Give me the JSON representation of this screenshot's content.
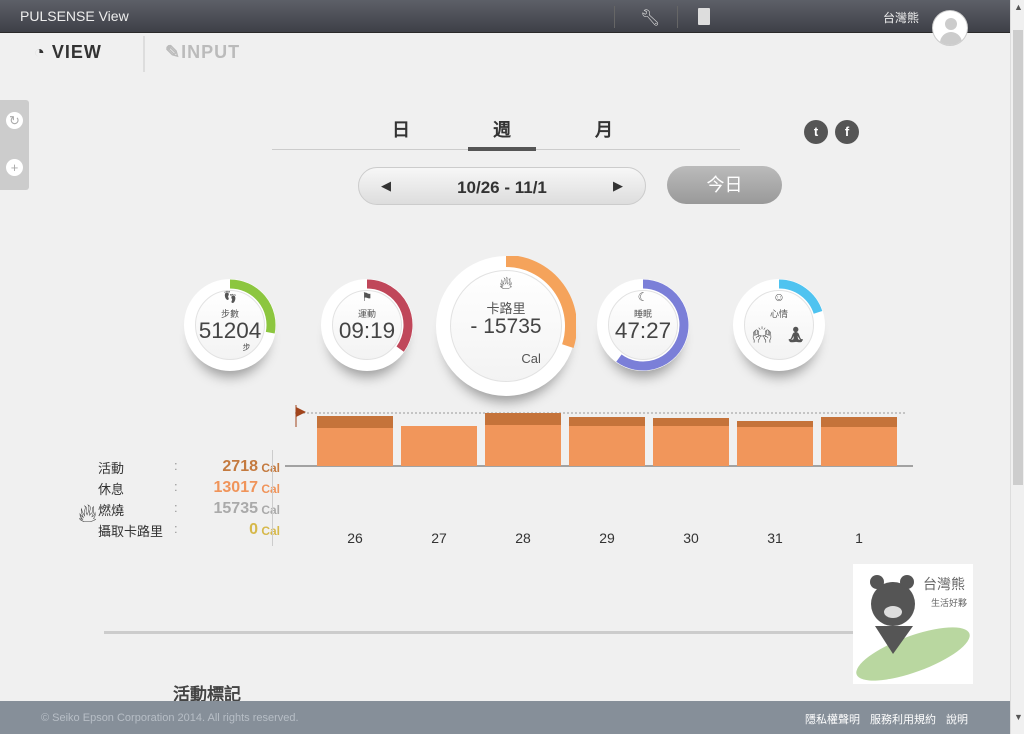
{
  "app": {
    "title": "PULSENSE View",
    "user": "台灣熊",
    "icons": [
      "wrench-icon",
      "door-exit-icon"
    ]
  },
  "modes": {
    "view": "VIEW",
    "input": "INPUT"
  },
  "periods": [
    {
      "label": "日"
    },
    {
      "label": "週",
      "active": true
    },
    {
      "label": "月"
    }
  ],
  "social": {
    "twitter": "t",
    "facebook": "f"
  },
  "date": {
    "range": "10/26 - 11/1",
    "prev": "◀",
    "next": "▶",
    "today": "今日"
  },
  "dials": {
    "steps": {
      "label": "步數",
      "value": "51204",
      "unit": "步",
      "color": "#8cc63f",
      "progress": 0.28
    },
    "exercise": {
      "label": "運動",
      "value": "09:19",
      "color": "#c0475a",
      "progress": 0.35
    },
    "calories": {
      "label": "卡路里",
      "value": "- 15735",
      "unit": "Cal",
      "color": "#f5a35b",
      "progress": 0.3
    },
    "sleep": {
      "label": "睡眠",
      "value": "47:27",
      "color": "#7b7fd8",
      "progress": 0.6
    },
    "mood": {
      "label": "心情",
      "color": "#4fc3f0",
      "progress": 0.2
    }
  },
  "legend": [
    {
      "key": "活動",
      "value": "2718",
      "unit": "Cal",
      "color": "#c47a3f"
    },
    {
      "key": "休息",
      "value": "13017",
      "unit": "Cal",
      "color": "#f0945a"
    },
    {
      "key": "燃燒",
      "value": "15735",
      "unit": "Cal",
      "color": "#aaaaaa"
    },
    {
      "key": "攝取卡路里",
      "value": "0",
      "unit": "Cal",
      "color": "#d6b84a"
    }
  ],
  "legend_sep": ":",
  "chart_data": {
    "type": "bar",
    "categories": [
      "26",
      "27",
      "28",
      "29",
      "30",
      "31",
      "1"
    ],
    "series": [
      {
        "name": "休息",
        "values": [
          38,
          40,
          41,
          40,
          40,
          39,
          39
        ]
      },
      {
        "name": "活動",
        "values": [
          12,
          0,
          12,
          9,
          8,
          6,
          10
        ]
      }
    ],
    "target": 53,
    "ylim": [
      0,
      60
    ]
  },
  "section": {
    "title": "活動標記"
  },
  "footer": {
    "copyright": "© Seiko Epson Corporation 2014. All rights reserved.",
    "links": [
      "隱私權聲明",
      "服務利用規約",
      "說明"
    ]
  }
}
